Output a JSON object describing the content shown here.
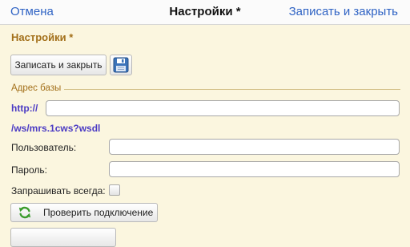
{
  "navbar": {
    "cancel_label": "Отмена",
    "title": "Настройки *",
    "save_close_label": "Записать и закрыть"
  },
  "form": {
    "title": "Настройки *",
    "save_close_button": "Записать и закрыть",
    "save_icon": "floppy-disk-icon"
  },
  "address_group": {
    "title": "Адрес базы",
    "prefix": "http://",
    "url_value": "",
    "suffix": "/ws/mrs.1cws?wsdl"
  },
  "fields": {
    "user_label": "Пользователь:",
    "user_value": "",
    "password_label": "Пароль:",
    "password_value": "",
    "always_ask_label": "Запрашивать всегда:",
    "always_ask_checked": false
  },
  "check_connection": {
    "label": "Проверить подключение",
    "icon": "refresh-icon"
  },
  "colors": {
    "background": "#fbf6df",
    "accent_link": "#2f63c4",
    "group_title": "#a3701a",
    "url_label": "#4b3bc4"
  }
}
